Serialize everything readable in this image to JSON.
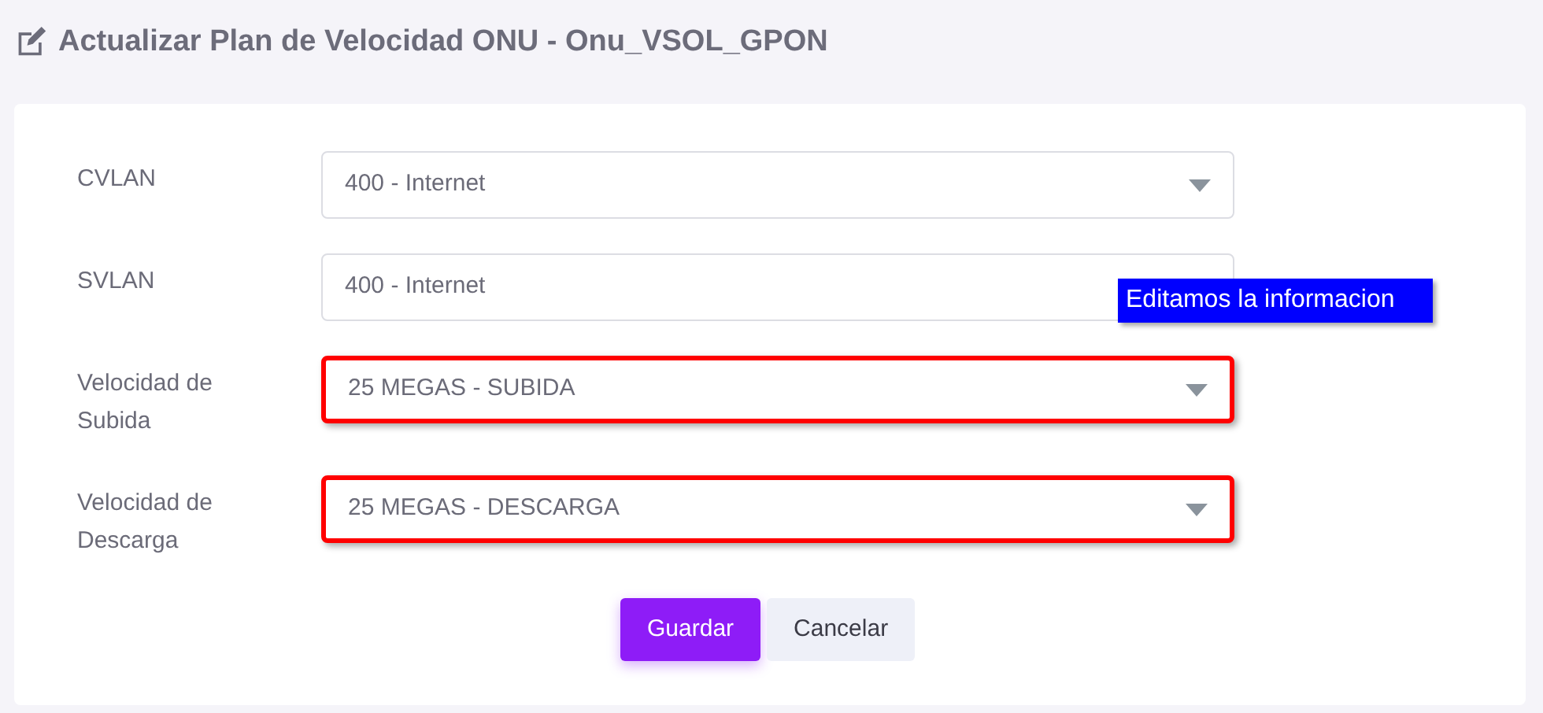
{
  "title": "Actualizar Plan de Velocidad ONU - Onu_VSOL_GPON",
  "fields": [
    {
      "label": "CVLAN",
      "value": "400 - Internet",
      "kind": "select",
      "highlighted": false
    },
    {
      "label": "SVLAN",
      "value": "400 - Internet",
      "kind": "input",
      "highlighted": false
    },
    {
      "label": "Velocidad de Subida",
      "value": "25 MEGAS - SUBIDA",
      "kind": "select",
      "highlighted": true
    },
    {
      "label": "Velocidad de Descarga",
      "value": "25 MEGAS - DESCARGA",
      "kind": "select",
      "highlighted": true
    }
  ],
  "buttons": [
    {
      "label": "Guardar",
      "kind": "primary"
    },
    {
      "label": "Cancelar",
      "kind": "secondary"
    }
  ],
  "annotation": "Editamos la informacion"
}
